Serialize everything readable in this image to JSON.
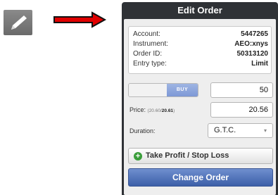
{
  "title": "Edit Order",
  "info": [
    {
      "label": "Account:",
      "value": "5447265"
    },
    {
      "label": "Instrument:",
      "value": "AEO:xnys"
    },
    {
      "label": "Order ID:",
      "value": "50313120"
    },
    {
      "label": "Entry type:",
      "value": "Limit"
    }
  ],
  "side": {
    "active": "BUY"
  },
  "quantity": "50",
  "price": {
    "label": "Price:",
    "range_low": "(20.60/",
    "range_high": "20.61",
    "range_close": ")",
    "value": "20.56"
  },
  "duration": {
    "label": "Duration:",
    "selected": "G.T.C."
  },
  "buttons": {
    "take_profit": "Take Profit / Stop Loss",
    "change_order": "Change Order"
  },
  "icons": [
    "pencil-icon",
    "right-arrow-icon",
    "plus-circle-icon",
    "chevron-down-icon"
  ],
  "colors": {
    "arrow": "#e00000",
    "header": "#2f3236",
    "primary": "#4a6db5",
    "buy": "#8aa4dc",
    "add": "#3a9d3a"
  }
}
